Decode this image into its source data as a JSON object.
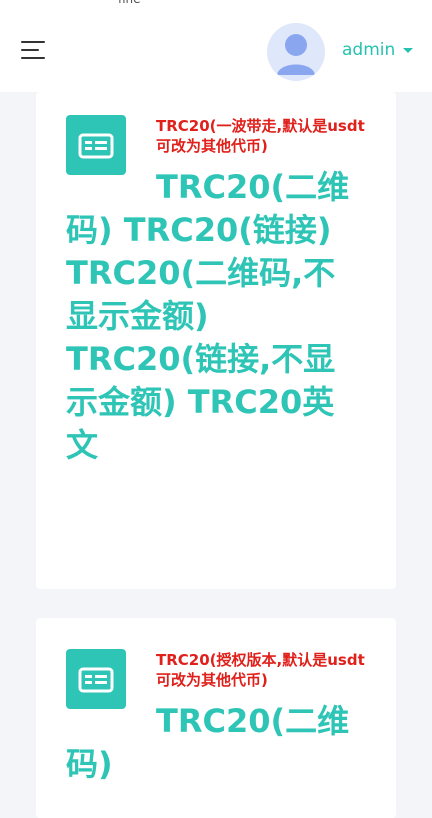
{
  "status": {
    "fragment": "fine"
  },
  "header": {
    "username": "admin",
    "icons": {
      "menu": "hamburger-menu-icon",
      "avatar": "user-avatar-icon",
      "caret": "caret-down-icon"
    },
    "colors": {
      "accent": "#27c1b1",
      "avatar_bg": "#dfe7fb",
      "avatar_fg": "#8aa6ee"
    }
  },
  "cards": [
    {
      "note": "TRC20(一波带走,默认是usdt可改为其他代币)",
      "icon": "card-list-icon",
      "links": [
        "TRC20(二维码)",
        "TRC20(链接)",
        "TRC20(二维码,不显示金额)",
        "TRC20(链接,不显示金额)",
        "TRC20英文"
      ]
    },
    {
      "note": "TRC20(授权版本,默认是usdt可改为其他代币)",
      "icon": "card-list-icon",
      "links": [
        "TRC20(二维码)"
      ]
    }
  ],
  "colors": {
    "link": "#2ec5b6",
    "note": "#e0201b",
    "page_bg": "#f4f5f9"
  }
}
